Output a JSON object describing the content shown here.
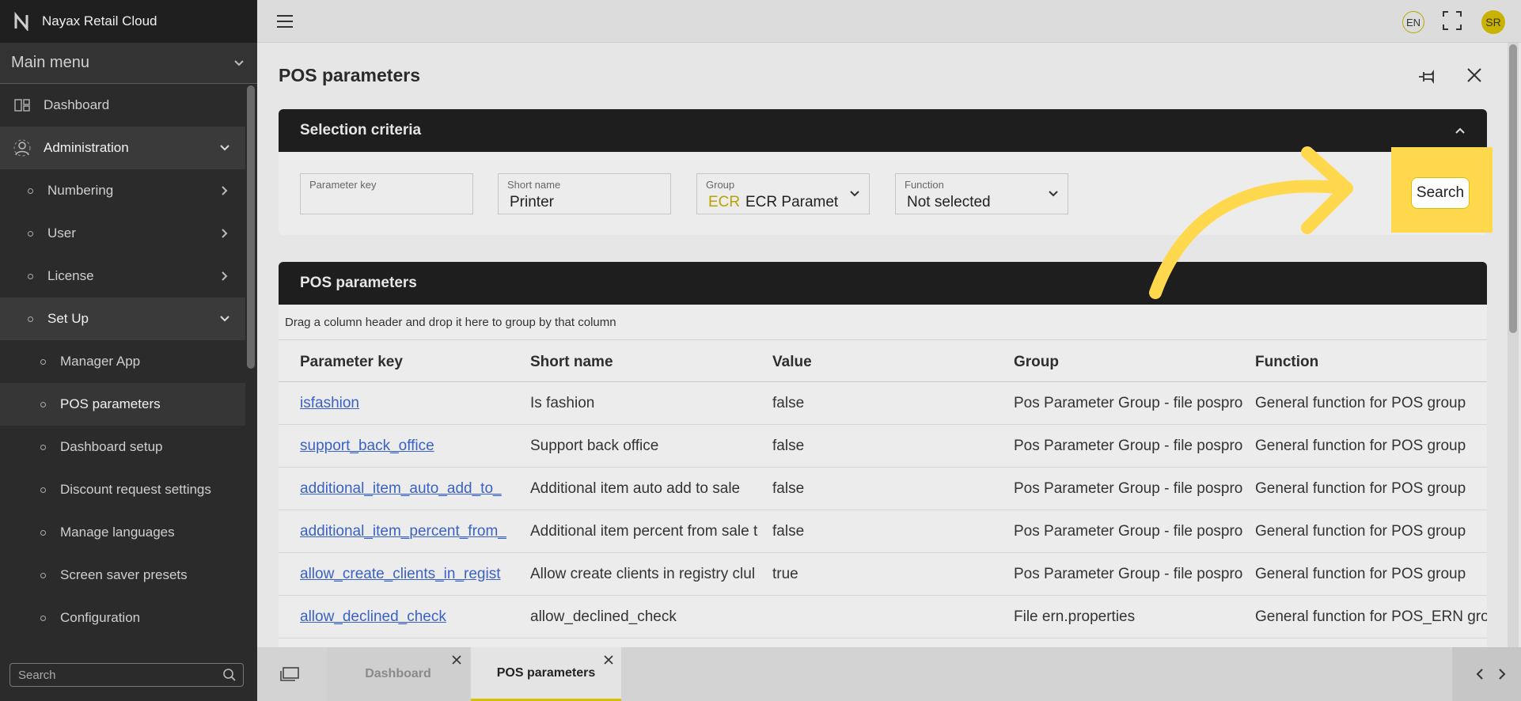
{
  "app": {
    "brand": "Nayax Retail Cloud"
  },
  "sidebar": {
    "main_menu": "Main menu",
    "items": [
      {
        "label": "Dashboard"
      },
      {
        "label": "Administration"
      },
      {
        "label": "Numbering"
      },
      {
        "label": "User"
      },
      {
        "label": "License"
      },
      {
        "label": "Set Up"
      },
      {
        "label": "Manager App"
      },
      {
        "label": "POS parameters"
      },
      {
        "label": "Dashboard setup"
      },
      {
        "label": "Discount request settings"
      },
      {
        "label": "Manage languages"
      },
      {
        "label": "Screen saver presets"
      },
      {
        "label": "Configuration"
      }
    ],
    "search_placeholder": "Search"
  },
  "topbar": {
    "language": "EN",
    "user_initials": "SR"
  },
  "page": {
    "title": "POS parameters"
  },
  "criteria": {
    "title": "Selection criteria",
    "fields": {
      "parameter_key": {
        "label": "Parameter key",
        "value": ""
      },
      "short_name": {
        "label": "Short name",
        "value": "Printer"
      },
      "group": {
        "label": "Group",
        "code": "ECR",
        "value": "ECR Paramet"
      },
      "function": {
        "label": "Function",
        "value": "Not selected"
      }
    },
    "search_button": "Search"
  },
  "grid": {
    "title": "POS parameters",
    "group_hint": "Drag a column header and drop it here to group by that column",
    "columns": [
      "Parameter key",
      "Short name",
      "Value",
      "Group",
      "Function"
    ],
    "rows": [
      [
        "isfashion",
        "Is fashion",
        "false",
        "Pos Parameter Group - file pospro",
        "General function for POS group"
      ],
      [
        "support_back_office",
        "Support back office",
        "false",
        "Pos Parameter Group - file pospro",
        "General function for POS group"
      ],
      [
        "additional_item_auto_add_to_",
        "Additional item auto add to sale",
        "false",
        "Pos Parameter Group - file pospro",
        "General function for POS group"
      ],
      [
        "additional_item_percent_from_",
        "Additional item percent from sale t",
        "false",
        "Pos Parameter Group - file pospro",
        "General function for POS group"
      ],
      [
        "allow_create_clients_in_regist",
        "Allow create clients in registry clul",
        "true",
        "Pos Parameter Group - file pospro",
        "General function for POS group"
      ],
      [
        "allow_declined_check",
        "allow_declined_check",
        "",
        "File ern.properties",
        "General function for POS_ERN gro"
      ]
    ]
  },
  "tabs": [
    {
      "label": "Dashboard",
      "active": false
    },
    {
      "label": "POS parameters",
      "active": true
    }
  ],
  "colors": {
    "accent": "#ffd84d",
    "link": "#3a62c4",
    "sidebar": "#2b2b2b",
    "header": "#1e1e1e"
  }
}
